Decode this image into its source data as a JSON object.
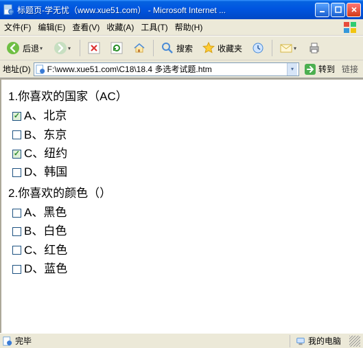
{
  "window": {
    "title": "标题页-学无忧（www.xue51.com） - Microsoft Internet ..."
  },
  "menu": {
    "file": "文件(F)",
    "edit": "编辑(E)",
    "view": "查看(V)",
    "favorites": "收藏(A)",
    "tools": "工具(T)",
    "help": "帮助(H)"
  },
  "toolbar": {
    "back": "后退",
    "search": "搜索",
    "favorites": "收藏夹"
  },
  "addressbar": {
    "label": "地址(D)",
    "value": "F:\\www.xue51.com\\C18\\18.4  多选考试题.htm",
    "go": "转到",
    "links": "链接"
  },
  "questions": [
    {
      "number": "1.",
      "text": "你喜欢的国家（AC）",
      "options": [
        {
          "label": "A、北京",
          "checked": true
        },
        {
          "label": "B、东京",
          "checked": false
        },
        {
          "label": "C、纽约",
          "checked": true
        },
        {
          "label": "D、韩国",
          "checked": false
        }
      ]
    },
    {
      "number": "2.",
      "text": "你喜欢的颜色（）",
      "options": [
        {
          "label": "A、黑色",
          "checked": false
        },
        {
          "label": "B、白色",
          "checked": false
        },
        {
          "label": "C、红色",
          "checked": false
        },
        {
          "label": "D、蓝色",
          "checked": false
        }
      ]
    }
  ],
  "status": {
    "done": "完毕",
    "zone": "我的电脑"
  }
}
